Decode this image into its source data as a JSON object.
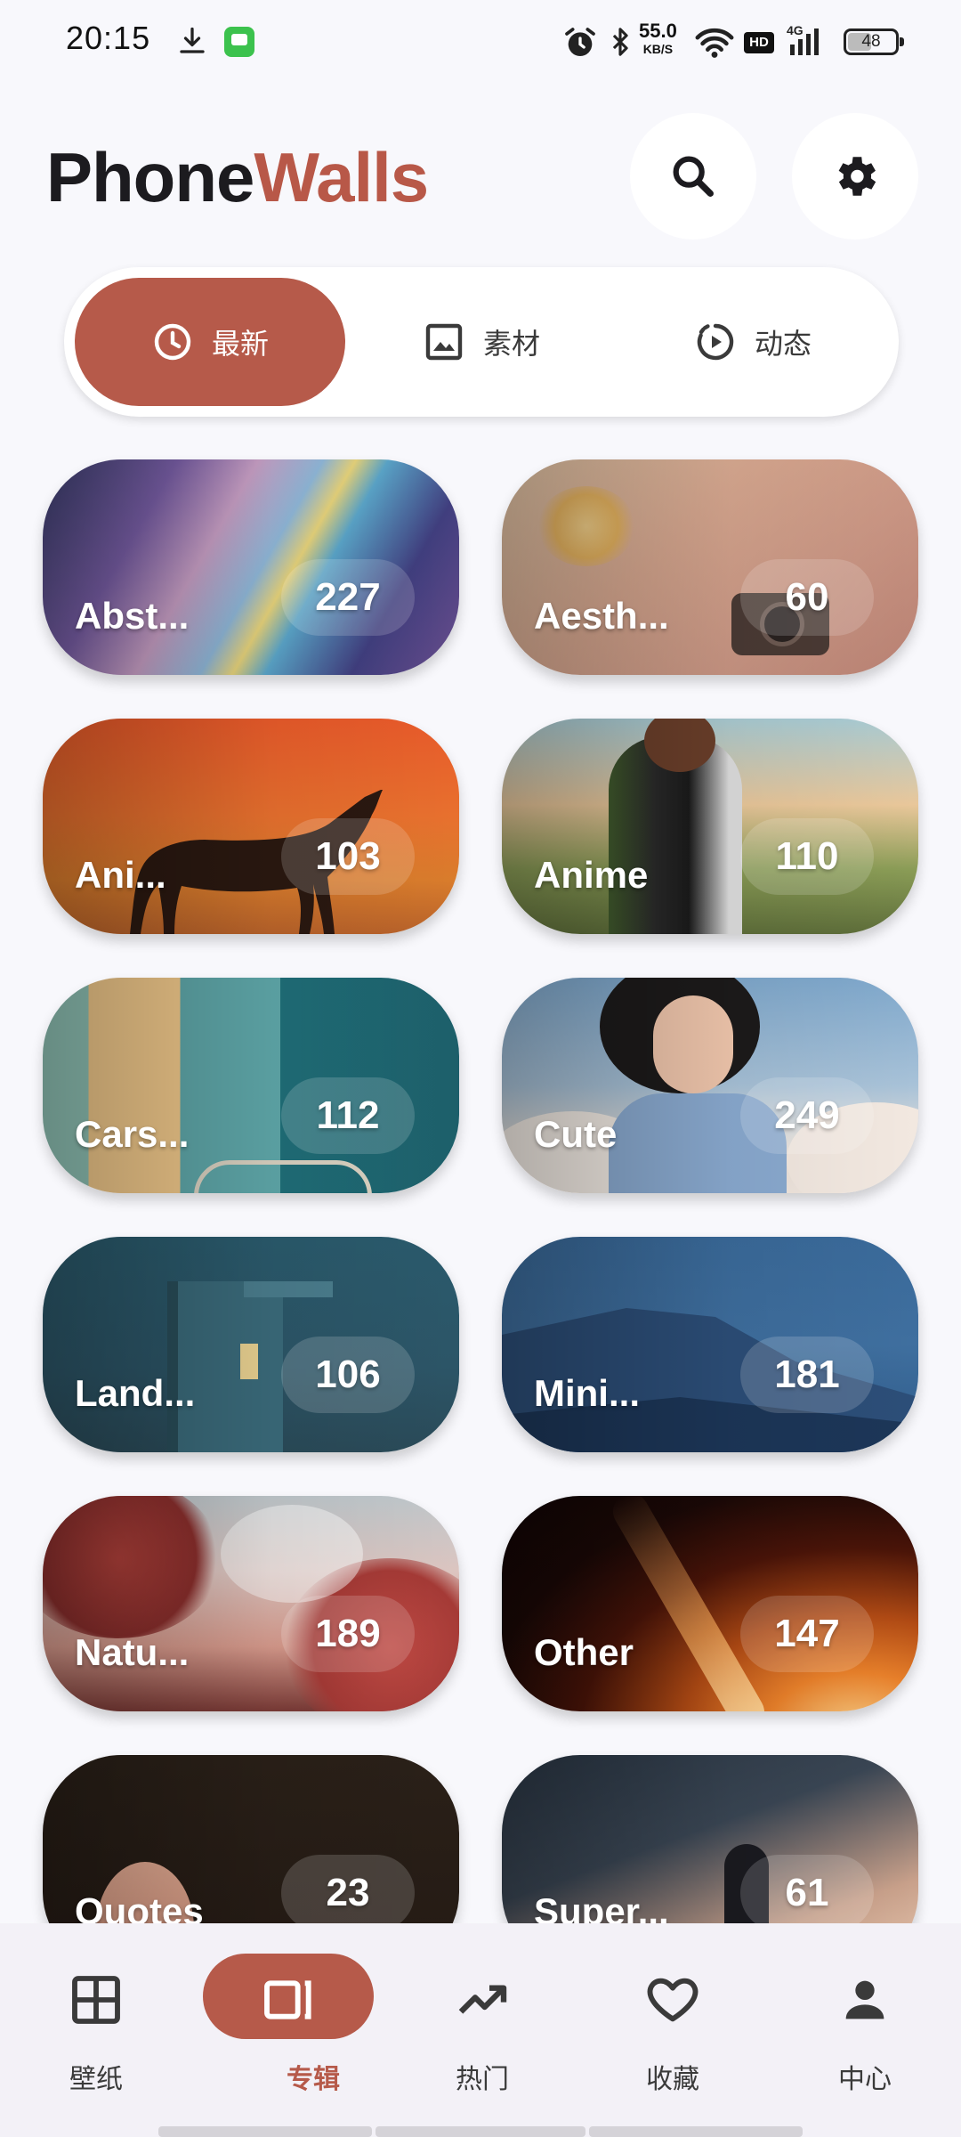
{
  "status_bar": {
    "time": "20:15",
    "net_speed_value": "55.0",
    "net_speed_unit": "KB/S",
    "hd_label": "HD",
    "network_label": "4G",
    "battery_level": "48",
    "icons": [
      "download-icon",
      "message-app-icon",
      "alarm-icon",
      "bluetooth-icon",
      "wifi-icon",
      "signal-icon",
      "battery-icon"
    ]
  },
  "header": {
    "title_part1": "Phone",
    "title_part2": "Walls",
    "title_colors": {
      "part1": "#1c1b1f",
      "part2": "#b85848"
    },
    "buttons": [
      "search-icon",
      "settings-icon"
    ]
  },
  "tabs": [
    {
      "label": "最新",
      "icon": "clock-icon",
      "active": true
    },
    {
      "label": "素材",
      "icon": "image-icon",
      "active": false
    },
    {
      "label": "动态",
      "icon": "play-circle-icon",
      "active": false
    }
  ],
  "categories": [
    {
      "name": "Abst...",
      "count": "227"
    },
    {
      "name": "Aesth...",
      "count": "60"
    },
    {
      "name": "Ani...",
      "count": "103"
    },
    {
      "name": "Anime",
      "count": "110"
    },
    {
      "name": "Cars...",
      "count": "112"
    },
    {
      "name": "Cute",
      "count": "249"
    },
    {
      "name": "Land...",
      "count": "106"
    },
    {
      "name": "Mini...",
      "count": "181"
    },
    {
      "name": "Natu...",
      "count": "189"
    },
    {
      "name": "Other",
      "count": "147"
    },
    {
      "name": "Quotes",
      "count": "23"
    },
    {
      "name": "Super...",
      "count": "61"
    }
  ],
  "bottom_nav": [
    {
      "label": "壁纸",
      "icon": "grid-icon",
      "active": false
    },
    {
      "label": "专辑",
      "icon": "album-icon",
      "active": true
    },
    {
      "label": "热门",
      "icon": "trending-icon",
      "active": false
    },
    {
      "label": "收藏",
      "icon": "heart-icon",
      "active": false
    },
    {
      "label": "中心",
      "icon": "person-icon",
      "active": false
    }
  ],
  "colors": {
    "accent": "#b65a4a",
    "background": "#f8f8fc",
    "nav_background": "#f3f1f7"
  }
}
